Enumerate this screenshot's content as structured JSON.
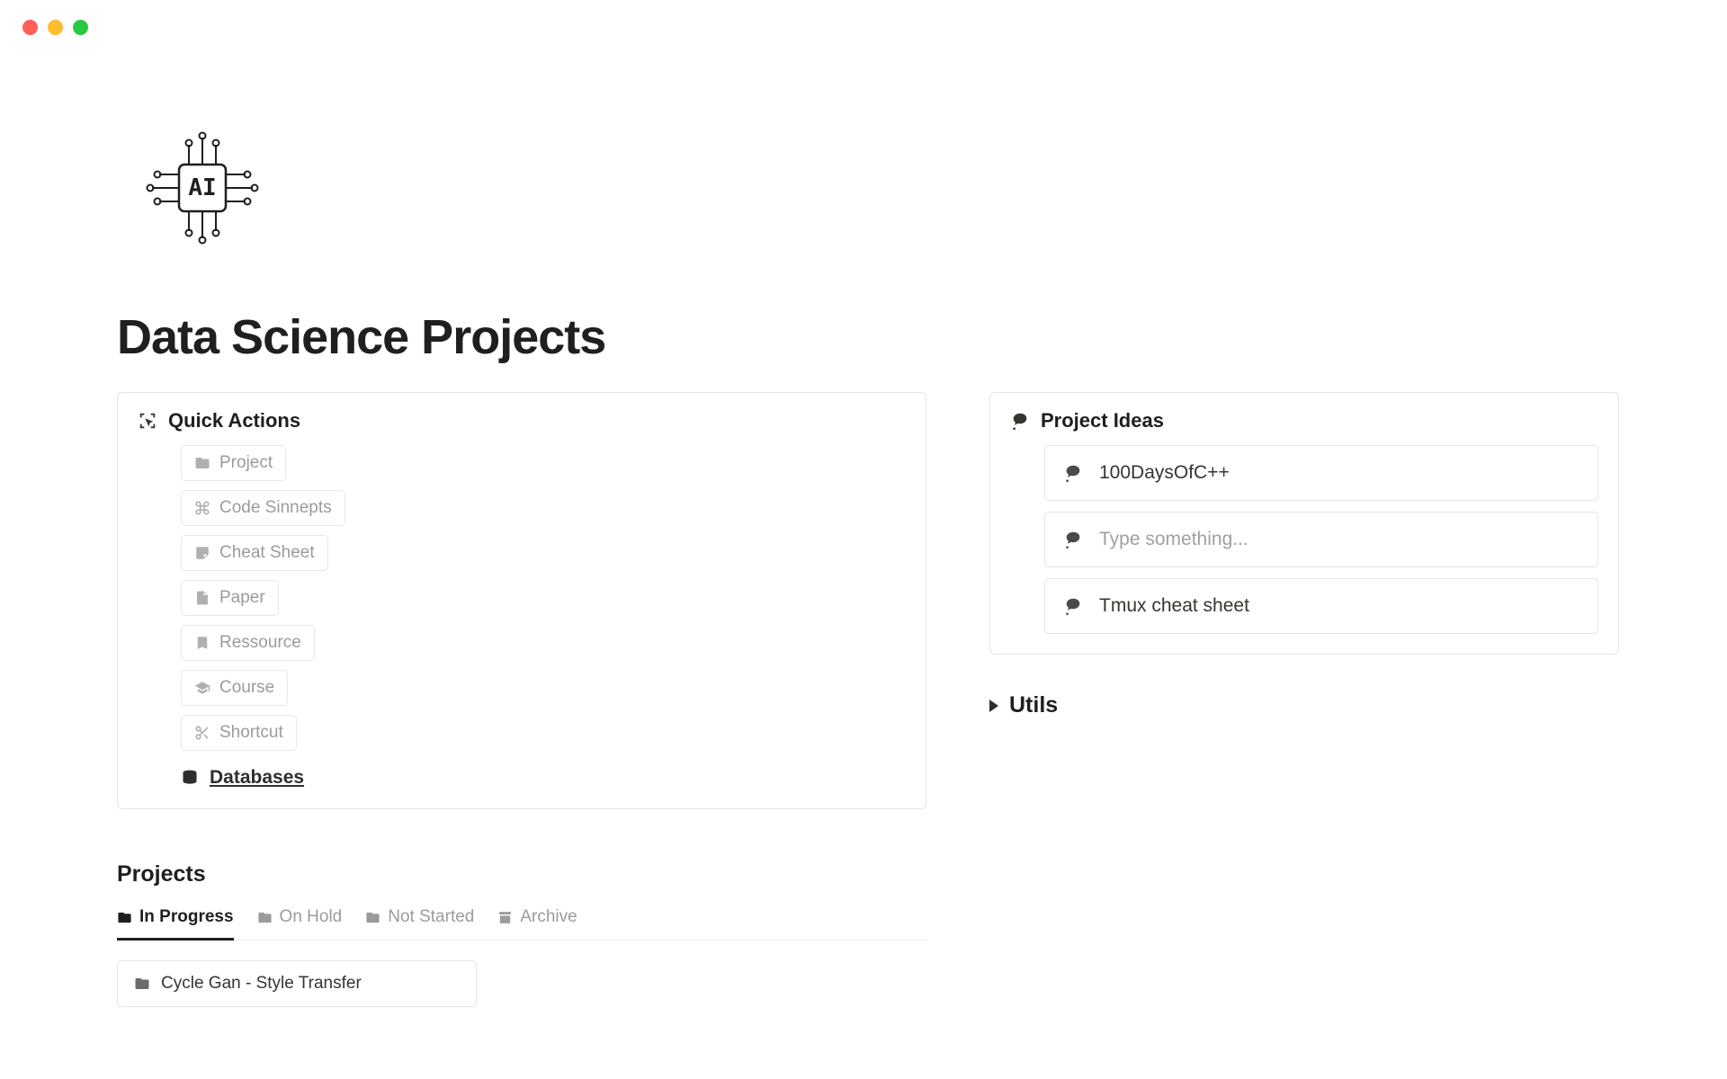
{
  "page": {
    "title": "Data Science Projects",
    "ai_logo_text": "AI"
  },
  "quick_actions": {
    "title": "Quick Actions",
    "items": [
      {
        "label": "Project",
        "icon": "folder-icon"
      },
      {
        "label": "Code Sinnepts",
        "icon": "command-icon"
      },
      {
        "label": "Cheat Sheet",
        "icon": "note-icon"
      },
      {
        "label": "Paper",
        "icon": "document-icon"
      },
      {
        "label": "Ressource",
        "icon": "bookmark-icon"
      },
      {
        "label": "Course",
        "icon": "graduation-icon"
      },
      {
        "label": "Shortcut",
        "icon": "scissors-icon"
      }
    ],
    "databases_label": "Databases"
  },
  "project_ideas": {
    "title": "Project Ideas",
    "items": [
      {
        "label": "100DaysOfC++",
        "type": "filled"
      },
      {
        "label": "Type something...",
        "type": "placeholder"
      },
      {
        "label": "Tmux cheat sheet",
        "type": "filled"
      }
    ]
  },
  "utils": {
    "title": "Utils"
  },
  "projects": {
    "title": "Projects",
    "tabs": [
      {
        "label": "In Progress",
        "active": true
      },
      {
        "label": "On Hold",
        "active": false
      },
      {
        "label": "Not Started",
        "active": false
      },
      {
        "label": "Archive",
        "active": false
      }
    ],
    "cards": [
      {
        "label": "Cycle Gan - Style Transfer"
      }
    ]
  }
}
